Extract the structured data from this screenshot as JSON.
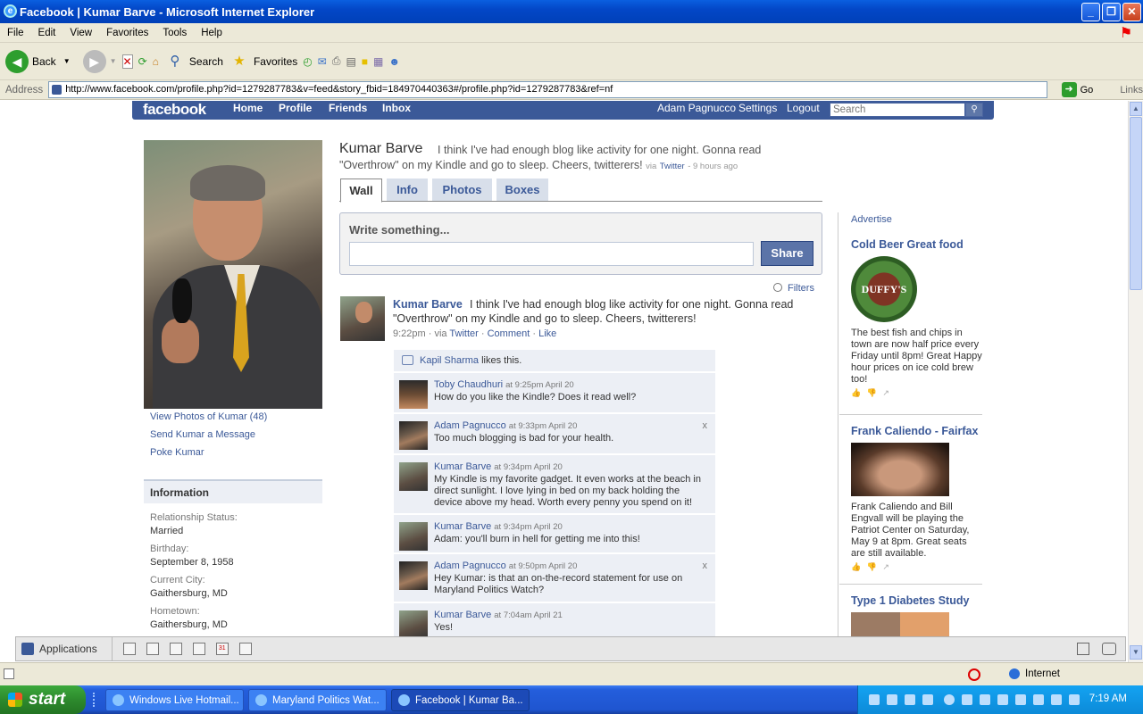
{
  "window": {
    "title": "Facebook | Kumar Barve - Microsoft Internet Explorer"
  },
  "menu": [
    "File",
    "Edit",
    "View",
    "Favorites",
    "Tools",
    "Help"
  ],
  "toolbar": {
    "back": "Back",
    "search": "Search",
    "favorites": "Favorites"
  },
  "address": {
    "label": "Address",
    "url": "http://www.facebook.com/profile.php?id=1279287783&v=feed&story_fbid=184970440363#/profile.php?id=1279287783&ref=nf",
    "go": "Go",
    "links": "Links"
  },
  "fb": {
    "logo": "facebook",
    "nav": [
      "Home",
      "Profile",
      "Friends",
      "Inbox"
    ],
    "user": "Adam Pagnucco",
    "settings": "Settings",
    "logout": "Logout",
    "search_placeholder": "Search"
  },
  "profile": {
    "name": "Kumar Barve",
    "status": "I think I've had enough blog like activity for one night. Gonna read \"Overthrow\" on my Kindle and go to sleep. Cheers, twitterers!",
    "status_via": "via",
    "status_source": "Twitter",
    "status_time": "- 9 hours ago",
    "links": {
      "photos": "View Photos of Kumar (48)",
      "message": "Send Kumar a Message",
      "poke": "Poke Kumar"
    },
    "info": {
      "heading": "Information",
      "relationship_label": "Relationship Status:",
      "relationship_value": "Married",
      "birthday_label": "Birthday:",
      "birthday_value": "September 8, 1958",
      "city_label": "Current City:",
      "city_value": "Gaithersburg, MD",
      "hometown_label": "Hometown:",
      "hometown_value": "Gaithersburg, MD"
    }
  },
  "tabs": [
    "Wall",
    "Info",
    "Photos",
    "Boxes"
  ],
  "composer": {
    "label": "Write something...",
    "share": "Share"
  },
  "filters": "Filters",
  "post": {
    "name": "Kumar Barve",
    "text": "I think I've had enough blog like activity for one night. Gonna read \"Overthrow\" on my Kindle and go to sleep. Cheers, twitterers!",
    "time": "9:22pm · via",
    "source": "Twitter",
    "sep": "·",
    "comment": "Comment",
    "like": "Like",
    "liker": "Kapil Sharma",
    "likes_text": "likes this."
  },
  "comments": [
    {
      "name": "Toby Chaudhuri",
      "time": "at 9:25pm April 20",
      "text": "How do you like the Kindle? Does it read well?"
    },
    {
      "name": "Adam Pagnucco",
      "time": "at 9:33pm April 20",
      "text": "Too much blogging is bad for your health.",
      "delete": "x"
    },
    {
      "name": "Kumar Barve",
      "time": "at 9:34pm April 20",
      "text": "My Kindle is my favorite gadget. It even works at the beach in direct sunlight. I love lying in bed on my back holding the device above my head. Worth every penny you spend on it!"
    },
    {
      "name": "Kumar Barve",
      "time": "at 9:34pm April 20",
      "text": "Adam: you'll burn in hell for getting me into this!"
    },
    {
      "name": "Adam Pagnucco",
      "time": "at 9:50pm April 20",
      "text": "Hey Kumar: is that an on-the-record statement for use on Maryland Politics Watch?",
      "delete": "x"
    },
    {
      "name": "Kumar Barve",
      "time": "at 7:04am April 21",
      "text": "Yes!"
    }
  ],
  "ads": {
    "advertise": "Advertise",
    "items": [
      {
        "title": "Cold Beer Great food",
        "logo_text": "DUFFY'S",
        "text": "The best fish and chips in town are now half price every Friday until 8pm! Great Happy hour prices on ice cold brew too!"
      },
      {
        "title": "Frank Caliendo - Fairfax",
        "text": "Frank Caliendo and Bill Engvall will be playing the Patriot Center on Saturday, May 9 at 8pm. Great seats are still available."
      },
      {
        "title": "Type 1 Diabetes Study"
      }
    ]
  },
  "appbar": {
    "applications": "Applications",
    "calendar_day": "31"
  },
  "statusbar": {
    "zone": "Internet"
  },
  "taskbar": {
    "start": "start",
    "tasks": [
      "Windows Live Hotmail...",
      "Maryland Politics Wat...",
      "Facebook | Kumar Ba..."
    ],
    "clock": "7:19 AM"
  },
  "colors": {
    "fb_blue": "#3b5998",
    "xp_blue": "#0347c7"
  }
}
